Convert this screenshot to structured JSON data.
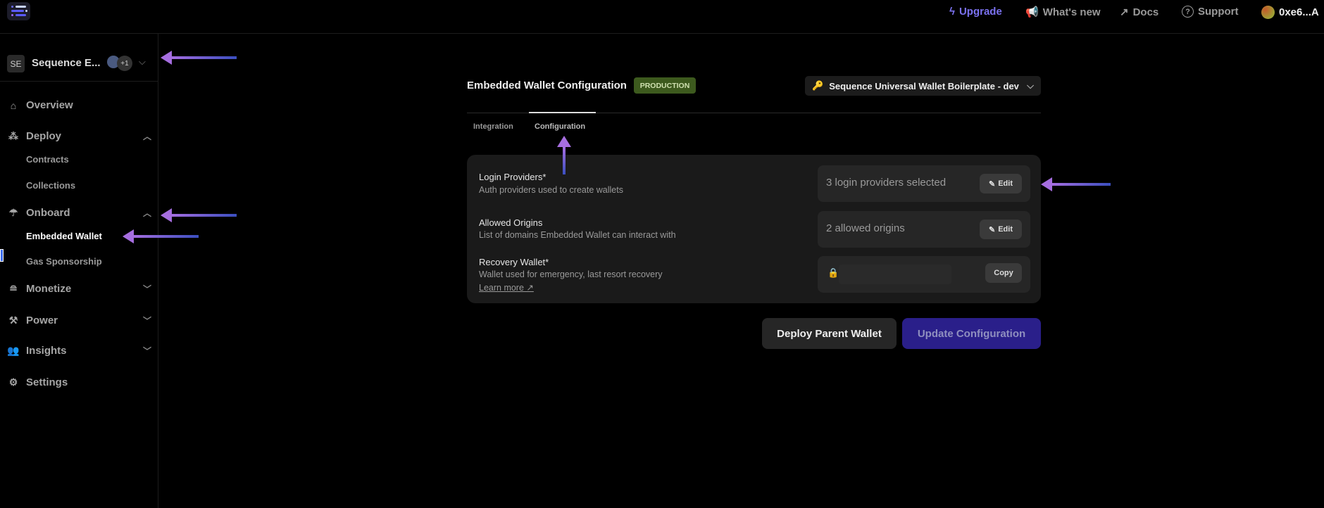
{
  "topbar": {
    "upgrade": "Upgrade",
    "whats_new": "What's new",
    "docs": "Docs",
    "support": "Support",
    "account": "0xe6...A"
  },
  "workspace": {
    "initials": "SE",
    "name": "Sequence E...",
    "extra_count": "+1"
  },
  "sidebar": {
    "overview": "Overview",
    "deploy": "Deploy",
    "contracts": "Contracts",
    "collections": "Collections",
    "onboard": "Onboard",
    "embedded_wallet": "Embedded Wallet",
    "gas_sponsorship": "Gas Sponsorship",
    "monetize": "Monetize",
    "power": "Power",
    "insights": "Insights",
    "settings": "Settings"
  },
  "main": {
    "title": "Embedded Wallet Configuration",
    "badge": "PRODUCTION",
    "project_selector": "Sequence Universal Wallet Boilerplate - dev",
    "tabs": [
      {
        "label": "Integration"
      },
      {
        "label": "Configuration",
        "active": true
      }
    ],
    "rows": [
      {
        "title": "Login Providers*",
        "description": "Auth providers used to create wallets",
        "value": "3 login providers selected",
        "action": "Edit"
      },
      {
        "title": "Allowed Origins",
        "description": "List of domains Embedded Wallet can interact with",
        "value": "2 allowed origins",
        "action": "Edit"
      },
      {
        "title": "Recovery Wallet*",
        "description": "Wallet used for emergency, last resort recovery",
        "link": "Learn more ↗",
        "action": "Copy"
      }
    ],
    "deploy_button": "Deploy Parent Wallet",
    "update_button": "Update Configuration"
  },
  "colors": {
    "accent": "#7b72f0",
    "badge_bg": "#3d5a1e",
    "update_bg": "#2a1f8a",
    "arrow": "#a66ee0"
  }
}
